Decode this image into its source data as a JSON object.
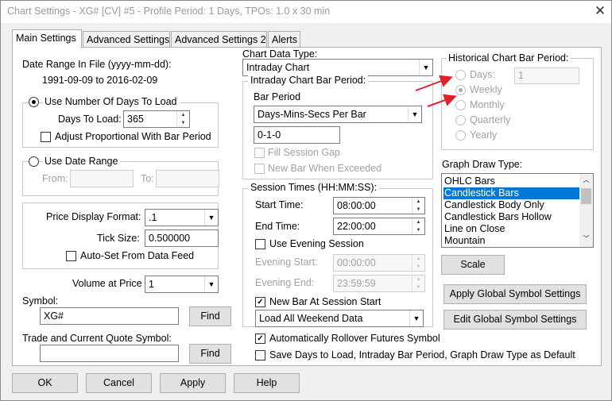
{
  "window": {
    "title": "Chart Settings - XG# [CV]  #5 - Profile Period: 1 Days, TPOs: 1.0 x 30 min",
    "close": "✕"
  },
  "tabs": [
    "Main Settings",
    "Advanced Settings",
    "Advanced Settings 2",
    "Alerts"
  ],
  "date_range": {
    "label": "Date Range In File (yyyy-mm-dd):",
    "value": "1991-09-09 to 2016-02-09"
  },
  "days_group": {
    "radio_label": "Use Number Of Days To Load",
    "days_label": "Days To Load:",
    "days_value": "365",
    "adjust_label": "Adjust Proportional With Bar Period"
  },
  "date_range_group": {
    "radio_label": "Use Date Range",
    "from_label": "From:",
    "to_label": "To:"
  },
  "price_group": {
    "format_label": "Price Display Format:",
    "format_value": ".1",
    "tick_label": "Tick Size:",
    "tick_value": "0.500000",
    "autoset_label": "Auto-Set From Data Feed"
  },
  "volume": {
    "label": "Volume at Price",
    "value": "1"
  },
  "symbol": {
    "label": "Symbol:",
    "value": "XG#",
    "find": "Find"
  },
  "trade_symbol": {
    "label": "Trade and Current Quote Symbol:",
    "value": "",
    "find": "Find"
  },
  "chart_data_type": {
    "label": "Chart Data Type:",
    "value": "Intraday Chart"
  },
  "intraday_period": {
    "title": "Intraday Chart Bar Period:",
    "bar_period_label": "Bar Period",
    "bar_period_value": "Days-Mins-Secs Per Bar",
    "period_value": "0-1-0",
    "fill_gap_label": "Fill Session Gap",
    "new_bar_exceeded_label": "New Bar When Exceeded"
  },
  "session": {
    "title": "Session Times (HH:MM:SS):",
    "start_label": "Start Time:",
    "start_value": "08:00:00",
    "end_label": "End Time:",
    "end_value": "22:00:00",
    "evening_label": "Use Evening Session",
    "evening_start_label": "Evening Start:",
    "evening_start_value": "00:00:00",
    "evening_end_label": "Evening End:",
    "evening_end_value": "23:59:59",
    "new_bar_label": "New Bar At Session Start",
    "weekend_value": "Load All Weekend Data"
  },
  "rollover_label": "Automatically Rollover Futures Symbol",
  "save_default_label": "Save Days to Load, Intraday Bar Period, Graph Draw Type as Default",
  "historical": {
    "title": "Historical Chart Bar Period:",
    "options": [
      "Days:",
      "Weekly",
      "Monthly",
      "Quarterly",
      "Yearly"
    ],
    "days_value": "1",
    "selected": "Weekly"
  },
  "graph_draw": {
    "label": "Graph Draw Type:",
    "items": [
      "OHLC Bars",
      "Candlestick Bars",
      "Candlestick Body Only",
      "Candlestick Bars Hollow",
      "Line on Close",
      "Mountain"
    ],
    "selected": "Candlestick Bars"
  },
  "buttons": {
    "scale": "Scale",
    "apply_global": "Apply Global Symbol Settings",
    "edit_global": "Edit Global Symbol Settings",
    "ok": "OK",
    "cancel": "Cancel",
    "apply": "Apply",
    "help": "Help"
  },
  "colors": {
    "selection": "#0078d7",
    "annotation_arrow": "#e0202a"
  }
}
